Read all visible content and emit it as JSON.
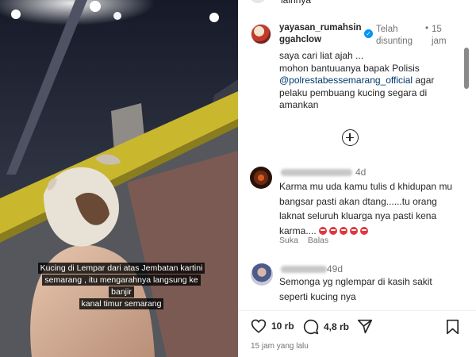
{
  "media": {
    "caption_lines": [
      "Kucing di Lempar dari atas Jembatan kartini",
      "semarang , itu mengarahnya langsung ke banjir",
      "kanal timur semarang"
    ]
  },
  "top_clip_text": "lainnya",
  "post": {
    "username": "yayasan_rumahsinggahclow",
    "edited_label": "Telah disunting",
    "separator": "•",
    "time": "15 jam",
    "lines": [
      "saya cari liat ajah ...",
      "mohon bantuuanya bapak Polisis"
    ],
    "mention": "@polrestabessemarang_official",
    "after_mention": " agar pelaku pembuang kucing segara di amankan"
  },
  "comments": [
    {
      "time": "4d",
      "text": "Karma mu uda kamu tulis d khidupan mu bangsar pasti akan dtang......tu orang laknat seluruh kluarga nya pasti kena karma....",
      "emoji_count": 5,
      "actions": [
        "Suka",
        "Balas"
      ]
    },
    {
      "time": "49d",
      "text": "Semonga yg nglempar di kasih sakit seperti kucing nya"
    }
  ],
  "actions": {
    "likes": "10 rb",
    "comments": "4,8 rb",
    "timestamp": "15 jam yang lalu"
  },
  "colors": {
    "accent_blue": "#0095f6",
    "mention_blue": "#00376b",
    "secondary_text": "#737373",
    "bridge_rail": "#c9b72e"
  }
}
